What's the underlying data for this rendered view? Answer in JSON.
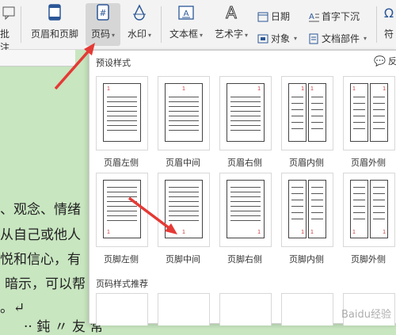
{
  "ribbon": {
    "annotate_label": "批注",
    "header_footer_label": "页眉和页脚",
    "page_number_label": "页码",
    "watermark_label": "水印",
    "textbox_label": "文本框",
    "wordart_label": "艺术字",
    "date_label": "日期",
    "object_label": "对象",
    "dropcap_label": "首字下沉",
    "docparts_label": "文档部件",
    "symbol_label": "符"
  },
  "document": {
    "lines": [
      "、观念、情绪",
      "从自己或他人",
      "悦和信心，有",
      "暗示，可以帮",
      "。↵",
      "·· 鈍 〃 友 常"
    ]
  },
  "panel": {
    "preset_title": "预设样式",
    "feedback_label": "反",
    "top_row": [
      "页眉左侧",
      "页眉中间",
      "页眉右侧",
      "页眉内侧",
      "页眉外侧"
    ],
    "bottom_row": [
      "页脚左侧",
      "页脚中间",
      "页脚右侧",
      "页脚内侧",
      "页脚外侧"
    ],
    "page_number_digit": "1",
    "recommend_title": "页码样式推荐"
  },
  "watermark_text": "Baidu经验",
  "colors": {
    "accent_red": "#e53935",
    "page_number_red": "#cc3333",
    "doc_background": "#c8e6c0"
  }
}
